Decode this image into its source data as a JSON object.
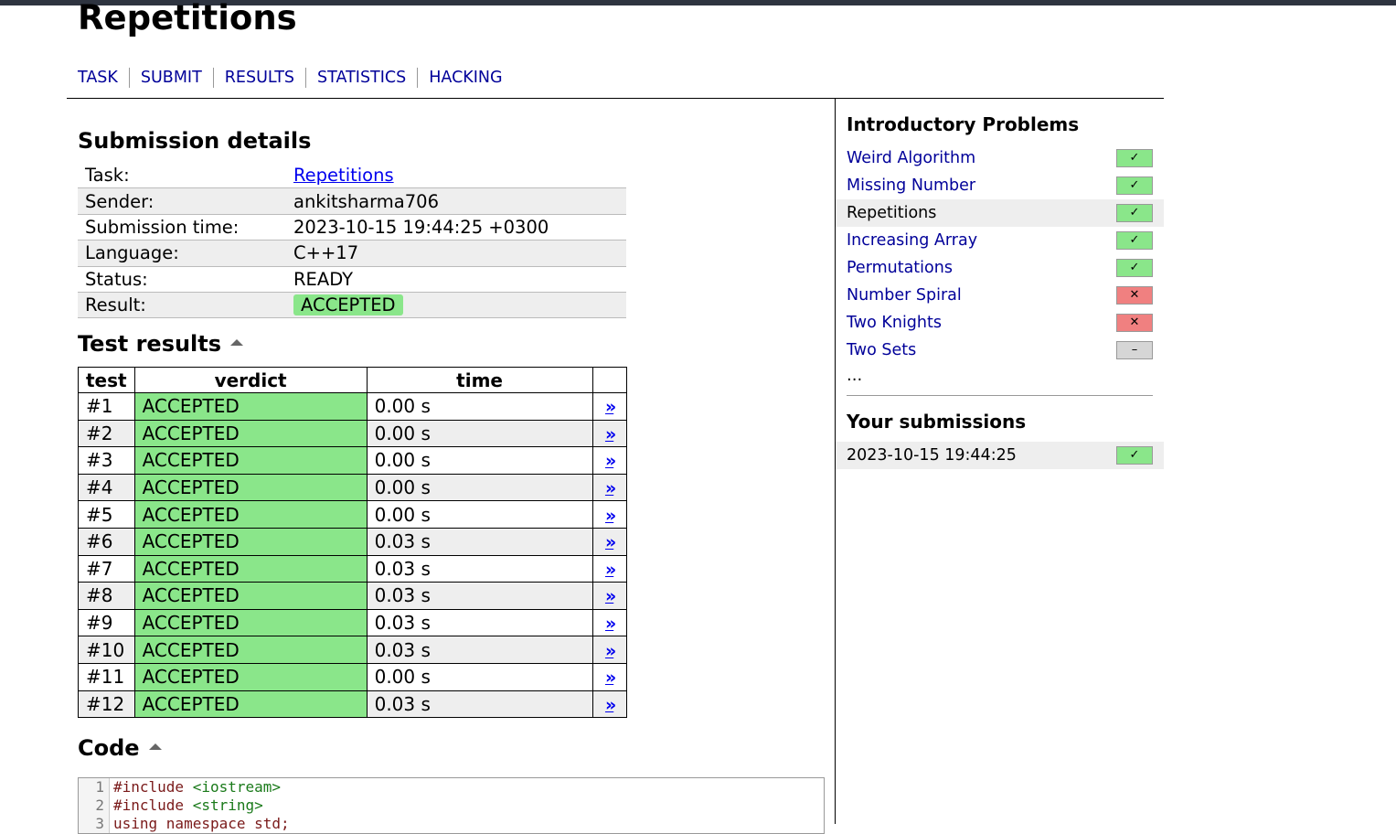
{
  "page_title": "Repetitions",
  "nav": [
    "TASK",
    "SUBMIT",
    "RESULTS",
    "STATISTICS",
    "HACKING"
  ],
  "submission": {
    "heading": "Submission details",
    "rows": [
      {
        "key": "Task:",
        "value": "Repetitions"
      },
      {
        "key": "Sender:",
        "value": "ankitsharma706"
      },
      {
        "key": "Submission time:",
        "value": "2023-10-15 19:44:25 +0300"
      },
      {
        "key": "Language:",
        "value": "C++17"
      },
      {
        "key": "Status:",
        "value": "READY"
      },
      {
        "key": "Result:",
        "value": "ACCEPTED"
      }
    ]
  },
  "tests": {
    "heading": "Test results",
    "columns": [
      "test",
      "verdict",
      "time"
    ],
    "link_glyph": "»",
    "rows": [
      {
        "test": "#1",
        "verdict": "ACCEPTED",
        "time": "0.00 s"
      },
      {
        "test": "#2",
        "verdict": "ACCEPTED",
        "time": "0.00 s"
      },
      {
        "test": "#3",
        "verdict": "ACCEPTED",
        "time": "0.00 s"
      },
      {
        "test": "#4",
        "verdict": "ACCEPTED",
        "time": "0.00 s"
      },
      {
        "test": "#5",
        "verdict": "ACCEPTED",
        "time": "0.00 s"
      },
      {
        "test": "#6",
        "verdict": "ACCEPTED",
        "time": "0.03 s"
      },
      {
        "test": "#7",
        "verdict": "ACCEPTED",
        "time": "0.03 s"
      },
      {
        "test": "#8",
        "verdict": "ACCEPTED",
        "time": "0.03 s"
      },
      {
        "test": "#9",
        "verdict": "ACCEPTED",
        "time": "0.03 s"
      },
      {
        "test": "#10",
        "verdict": "ACCEPTED",
        "time": "0.03 s"
      },
      {
        "test": "#11",
        "verdict": "ACCEPTED",
        "time": "0.00 s"
      },
      {
        "test": "#12",
        "verdict": "ACCEPTED",
        "time": "0.03 s"
      }
    ]
  },
  "code": {
    "heading": "Code",
    "lines": [
      {
        "n": "1",
        "directive": "#include",
        "arg": "<iostream>"
      },
      {
        "n": "2",
        "directive": "#include",
        "arg": "<string>"
      },
      {
        "n": "3",
        "directive": "using namespace std;",
        "arg": ""
      }
    ]
  },
  "sidebar": {
    "title": "Introductory Problems",
    "problems": [
      {
        "name": "Weird Algorithm",
        "status": "ok",
        "current": false
      },
      {
        "name": "Missing Number",
        "status": "ok",
        "current": false
      },
      {
        "name": "Repetitions",
        "status": "ok",
        "current": true
      },
      {
        "name": "Increasing Array",
        "status": "ok",
        "current": false
      },
      {
        "name": "Permutations",
        "status": "ok",
        "current": false
      },
      {
        "name": "Number Spiral",
        "status": "bad",
        "current": false
      },
      {
        "name": "Two Knights",
        "status": "bad",
        "current": false
      },
      {
        "name": "Two Sets",
        "status": "none",
        "current": false
      }
    ],
    "more": "...",
    "status_glyphs": {
      "ok": "✓",
      "bad": "✕",
      "none": "–"
    },
    "submissions_title": "Your submissions",
    "submissions": [
      {
        "time": "2023-10-15 19:44:25",
        "status": "ok"
      }
    ]
  }
}
